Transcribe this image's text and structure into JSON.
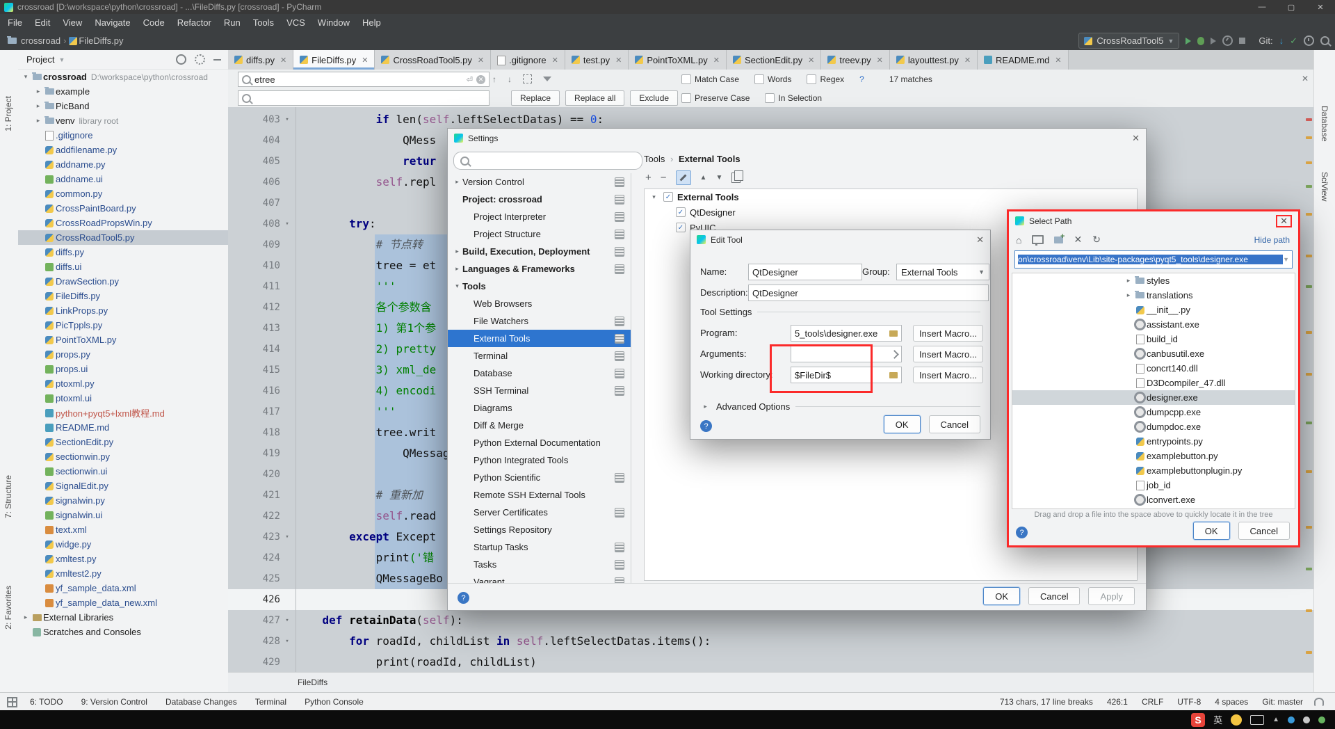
{
  "window": {
    "title": "crossroad [D:\\workspace\\python\\crossroad] - ...\\FileDiffs.py [crossroad] - PyCharm"
  },
  "menu": [
    "File",
    "Edit",
    "View",
    "Navigate",
    "Code",
    "Refactor",
    "Run",
    "Tools",
    "VCS",
    "Window",
    "Help"
  ],
  "nav": {
    "crumb1": "crossroad",
    "crumb2": "FileDiffs.py",
    "run_config": "CrossRoadTool5",
    "git_label": "Git:"
  },
  "stripes": {
    "left_top": "1: Project",
    "left_mid": "7: Structure",
    "left_bottom": "2: Favorites",
    "right_top": "Database",
    "right_bottom": "SciView"
  },
  "project": {
    "header": "Project",
    "items": [
      {
        "name": "crossroad",
        "suffix": "D:\\workspace\\python\\crossroad",
        "icon": "folder",
        "lvl": 0,
        "chev": "open",
        "bold": true,
        "color": "plain"
      },
      {
        "name": "example",
        "icon": "folder",
        "lvl": 1,
        "chev": "closed",
        "color": "plain"
      },
      {
        "name": "PicBand",
        "icon": "folder",
        "lvl": 1,
        "chev": "closed",
        "color": "plain"
      },
      {
        "name": "venv",
        "suffix": "library root",
        "icon": "folder",
        "lvl": 1,
        "chev": "closed",
        "color": "plain"
      },
      {
        "name": ".gitignore",
        "icon": "file",
        "lvl": 1,
        "color": "blue"
      },
      {
        "name": "addfilename.py",
        "icon": "py",
        "lvl": 1,
        "color": "blue"
      },
      {
        "name": "addname.py",
        "icon": "py",
        "lvl": 1,
        "color": "blue"
      },
      {
        "name": "addname.ui",
        "icon": "ui",
        "lvl": 1,
        "color": "blue"
      },
      {
        "name": "common.py",
        "icon": "py",
        "lvl": 1,
        "color": "blue"
      },
      {
        "name": "CrossPaintBoard.py",
        "icon": "py",
        "lvl": 1,
        "color": "blue"
      },
      {
        "name": "CrossRoadPropsWin.py",
        "icon": "py",
        "lvl": 1,
        "color": "blue"
      },
      {
        "name": "CrossRoadTool5.py",
        "icon": "py",
        "lvl": 1,
        "color": "blue",
        "sel": true
      },
      {
        "name": "diffs.py",
        "icon": "py",
        "lvl": 1,
        "color": "blue"
      },
      {
        "name": "diffs.ui",
        "icon": "ui",
        "lvl": 1,
        "color": "blue"
      },
      {
        "name": "DrawSection.py",
        "icon": "py",
        "lvl": 1,
        "color": "blue"
      },
      {
        "name": "FileDiffs.py",
        "icon": "py",
        "lvl": 1,
        "color": "blue"
      },
      {
        "name": "LinkProps.py",
        "icon": "py",
        "lvl": 1,
        "color": "blue"
      },
      {
        "name": "PicTppls.py",
        "icon": "py",
        "lvl": 1,
        "color": "blue"
      },
      {
        "name": "PointToXML.py",
        "icon": "py",
        "lvl": 1,
        "color": "blue"
      },
      {
        "name": "props.py",
        "icon": "py",
        "lvl": 1,
        "color": "blue"
      },
      {
        "name": "props.ui",
        "icon": "ui",
        "lvl": 1,
        "color": "blue"
      },
      {
        "name": "ptoxml.py",
        "icon": "py",
        "lvl": 1,
        "color": "blue"
      },
      {
        "name": "ptoxml.ui",
        "icon": "ui",
        "lvl": 1,
        "color": "blue"
      },
      {
        "name": "python+pyqt5+lxml教程.md",
        "icon": "md",
        "lvl": 1,
        "color": "red"
      },
      {
        "name": "README.md",
        "icon": "md",
        "lvl": 1,
        "color": "blue"
      },
      {
        "name": "SectionEdit.py",
        "icon": "py",
        "lvl": 1,
        "color": "blue"
      },
      {
        "name": "sectionwin.py",
        "icon": "py",
        "lvl": 1,
        "color": "blue"
      },
      {
        "name": "sectionwin.ui",
        "icon": "ui",
        "lvl": 1,
        "color": "blue"
      },
      {
        "name": "SignalEdit.py",
        "icon": "py",
        "lvl": 1,
        "color": "blue"
      },
      {
        "name": "signalwin.py",
        "icon": "py",
        "lvl": 1,
        "color": "blue"
      },
      {
        "name": "signalwin.ui",
        "icon": "ui",
        "lvl": 1,
        "color": "blue"
      },
      {
        "name": "text.xml",
        "icon": "xml",
        "lvl": 1,
        "color": "blue"
      },
      {
        "name": "widge.py",
        "icon": "py",
        "lvl": 1,
        "color": "blue"
      },
      {
        "name": "xmltest.py",
        "icon": "py",
        "lvl": 1,
        "color": "blue"
      },
      {
        "name": "xmltest2.py",
        "icon": "py",
        "lvl": 1,
        "color": "blue"
      },
      {
        "name": "yf_sample_data.xml",
        "icon": "xml",
        "lvl": 1,
        "color": "blue"
      },
      {
        "name": "yf_sample_data_new.xml",
        "icon": "xml",
        "lvl": 1,
        "color": "blue"
      },
      {
        "name": "External Libraries",
        "icon": "lib",
        "lvl": 0,
        "chev": "closed",
        "color": "plain"
      },
      {
        "name": "Scratches and Consoles",
        "icon": "scratch",
        "lvl": 0,
        "color": "plain"
      }
    ]
  },
  "editor": {
    "tabs": [
      {
        "label": "diffs.py",
        "icon": "py"
      },
      {
        "label": "FileDiffs.py",
        "icon": "py",
        "active": true
      },
      {
        "label": "CrossRoadTool5.py",
        "icon": "py"
      },
      {
        "label": ".gitignore",
        "icon": "file"
      },
      {
        "label": "test.py",
        "icon": "py"
      },
      {
        "label": "PointToXML.py",
        "icon": "py"
      },
      {
        "label": "SectionEdit.py",
        "icon": "py"
      },
      {
        "label": "treev.py",
        "icon": "py"
      },
      {
        "label": "layouttest.py",
        "icon": "py"
      },
      {
        "label": "README.md",
        "icon": "md"
      }
    ],
    "search": {
      "query": "etree",
      "matches": "17 matches",
      "opt_case": "Match Case",
      "opt_words": "Words",
      "opt_regex": "Regex",
      "regex_help": "?",
      "btn_replace": "Replace",
      "btn_replace_all": "Replace all",
      "btn_exclude": "Exclude",
      "opt_preserve": "Preserve Case",
      "opt_insel": "In Selection"
    },
    "gutter_first": 403,
    "current_line": 426,
    "folds": [
      403,
      408,
      423,
      427,
      428
    ],
    "lines": [
      {
        "ind": 12,
        "seg": [
          [
            "if ",
            "kw"
          ],
          [
            "len(",
            "pl"
          ],
          [
            "self",
            "slf"
          ],
          [
            ".leftSelectDatas) == ",
            "pl"
          ],
          [
            "0",
            "num"
          ],
          [
            ":",
            "pl"
          ]
        ]
      },
      {
        "ind": 16,
        "seg": [
          [
            "QMess",
            "pl"
          ]
        ]
      },
      {
        "ind": 16,
        "seg": [
          [
            "retur",
            "kw"
          ]
        ]
      },
      {
        "ind": 12,
        "seg": [
          [
            "self",
            "slf"
          ],
          [
            ".repl",
            "pl"
          ]
        ]
      },
      {
        "ind": 0,
        "seg": []
      },
      {
        "ind": 8,
        "seg": [
          [
            "try",
            "kw"
          ],
          [
            ":",
            "pl"
          ]
        ]
      },
      {
        "ind": 12,
        "seg": [
          [
            "# 节点转",
            "com"
          ]
        ]
      },
      {
        "ind": 12,
        "seg": [
          [
            "tree = et",
            "pl"
          ]
        ]
      },
      {
        "ind": 12,
        "seg": [
          [
            "'''",
            "str"
          ]
        ]
      },
      {
        "ind": 12,
        "seg": [
          [
            "各个参数含",
            "str"
          ]
        ]
      },
      {
        "ind": 12,
        "seg": [
          [
            "1) 第1个参",
            "str"
          ]
        ]
      },
      {
        "ind": 12,
        "seg": [
          [
            "2) pretty",
            "str"
          ]
        ]
      },
      {
        "ind": 12,
        "seg": [
          [
            "3) xml_de",
            "str"
          ]
        ]
      },
      {
        "ind": 12,
        "seg": [
          [
            "4) encodi",
            "str"
          ]
        ]
      },
      {
        "ind": 12,
        "seg": [
          [
            "'''",
            "str"
          ]
        ]
      },
      {
        "ind": 12,
        "seg": [
          [
            "tree.writ",
            "pl"
          ]
        ]
      },
      {
        "ind": 16,
        "seg": [
          [
            "QMessageBo",
            "pl"
          ]
        ]
      },
      {
        "ind": 0,
        "seg": []
      },
      {
        "ind": 12,
        "seg": [
          [
            "# 重新加",
            "com"
          ]
        ]
      },
      {
        "ind": 12,
        "seg": [
          [
            "self",
            "slf"
          ],
          [
            ".read",
            "pl"
          ]
        ]
      },
      {
        "ind": 8,
        "seg": [
          [
            "except ",
            "kw"
          ],
          [
            "Except",
            "pl"
          ]
        ]
      },
      {
        "ind": 12,
        "seg": [
          [
            "print",
            "pl"
          ],
          [
            "('错",
            "str"
          ]
        ]
      },
      {
        "ind": 12,
        "seg": [
          [
            "QMessageBo",
            "pl"
          ]
        ]
      },
      {
        "ind": 0,
        "seg": []
      },
      {
        "ind": 4,
        "seg": [
          [
            "def ",
            "kw"
          ],
          [
            "retainData",
            "fn"
          ],
          [
            "(",
            "pl"
          ],
          [
            "self",
            "slf"
          ],
          [
            "):",
            "pl"
          ]
        ]
      },
      {
        "ind": 8,
        "seg": [
          [
            "for ",
            "kw"
          ],
          [
            "roadId, childList ",
            "pl"
          ],
          [
            "in ",
            "kw"
          ],
          [
            "self",
            "slf"
          ],
          [
            ".leftSelectDatas.items():",
            "pl"
          ]
        ]
      },
      {
        "ind": 12,
        "seg": [
          [
            "print",
            "pl"
          ],
          [
            "(roadId, childList)",
            "pl"
          ]
        ]
      }
    ],
    "breadcrumb": "FileDiffs",
    "marks": [
      {
        "t": 16,
        "c": "#cf5b56"
      },
      {
        "t": 42,
        "c": "#d9a343"
      },
      {
        "t": 78,
        "c": "#d9a343"
      },
      {
        "t": 112,
        "c": "#7aa35c"
      },
      {
        "t": 152,
        "c": "#d9a343"
      },
      {
        "t": 212,
        "c": "#d9a343"
      },
      {
        "t": 256,
        "c": "#7aa35c"
      },
      {
        "t": 322,
        "c": "#d9a343"
      },
      {
        "t": 382,
        "c": "#d9a343"
      },
      {
        "t": 452,
        "c": "#7aa35c"
      },
      {
        "t": 522,
        "c": "#d9a343"
      },
      {
        "t": 602,
        "c": "#d9a343"
      },
      {
        "t": 662,
        "c": "#7aa35c"
      },
      {
        "t": 722,
        "c": "#d9a343"
      },
      {
        "t": 782,
        "c": "#d9a343"
      }
    ]
  },
  "settings": {
    "title": "Settings",
    "crumb1": "Tools",
    "crumb2": "External Tools",
    "tree": [
      {
        "label": "Version Control",
        "lvl": 0,
        "chev": "closed",
        "badge": true
      },
      {
        "label": "Project: crossroad",
        "lvl": 0,
        "bold": true,
        "badge": true
      },
      {
        "label": "Project Interpreter",
        "lvl": 1,
        "badge": true
      },
      {
        "label": "Project Structure",
        "lvl": 1,
        "badge": true
      },
      {
        "label": "Build, Execution, Deployment",
        "lvl": 0,
        "bold": true,
        "chev": "closed",
        "badge": true
      },
      {
        "label": "Languages & Frameworks",
        "lvl": 0,
        "bold": true,
        "chev": "closed",
        "badge": true
      },
      {
        "label": "Tools",
        "lvl": 0,
        "bold": true,
        "chev": "open"
      },
      {
        "label": "Web Browsers",
        "lvl": 1
      },
      {
        "label": "File Watchers",
        "lvl": 1,
        "badge": true
      },
      {
        "label": "External Tools",
        "lvl": 1,
        "sel": true,
        "badge": true
      },
      {
        "label": "Terminal",
        "lvl": 1,
        "badge": true
      },
      {
        "label": "Database",
        "lvl": 1,
        "badge": true
      },
      {
        "label": "SSH Terminal",
        "lvl": 1,
        "badge": true
      },
      {
        "label": "Diagrams",
        "lvl": 1
      },
      {
        "label": "Diff & Merge",
        "lvl": 1
      },
      {
        "label": "Python External Documentation",
        "lvl": 1
      },
      {
        "label": "Python Integrated Tools",
        "lvl": 1
      },
      {
        "label": "Python Scientific",
        "lvl": 1,
        "badge": true
      },
      {
        "label": "Remote SSH External Tools",
        "lvl": 1
      },
      {
        "label": "Server Certificates",
        "lvl": 1,
        "badge": true
      },
      {
        "label": "Settings Repository",
        "lvl": 1
      },
      {
        "label": "Startup Tasks",
        "lvl": 1,
        "badge": true
      },
      {
        "label": "Tasks",
        "lvl": 1,
        "badge": true
      },
      {
        "label": "Vagrant",
        "lvl": 1,
        "badge": true
      }
    ],
    "tools": [
      {
        "label": "External Tools",
        "chev": true,
        "checked": true,
        "bold": true,
        "lvl": 0
      },
      {
        "label": "QtDesigner",
        "checked": true,
        "lvl": 1
      },
      {
        "label": "PyUIC",
        "checked": true,
        "lvl": 1
      }
    ],
    "ok": "OK",
    "cancel": "Cancel",
    "apply": "Apply"
  },
  "edit_tool": {
    "title": "Edit Tool",
    "name_label": "Name:",
    "name_value": "QtDesigner",
    "group_label": "Group:",
    "group_value": "External Tools",
    "desc_label": "Description:",
    "desc_value": "QtDesigner",
    "section": "Tool Settings",
    "program_label": "Program:",
    "program_value": "5_tools\\designer.exe",
    "arguments_label": "Arguments:",
    "arguments_value": "",
    "workdir_label": "Working directory:",
    "workdir_value": "$FileDir$",
    "insert_macro": "Insert Macro...",
    "advanced": "Advanced Options",
    "ok": "OK",
    "cancel": "Cancel"
  },
  "select_path": {
    "title": "Select Path",
    "hide_path": "Hide path",
    "path_value": "on\\crossroad\\venv\\Lib\\site-packages\\pyqt5_tools\\designer.exe",
    "tree": [
      {
        "label": "styles",
        "icon": "folder",
        "chev": true
      },
      {
        "label": "translations",
        "icon": "folder",
        "chev": true
      },
      {
        "label": "__init__.py",
        "icon": "py"
      },
      {
        "label": "assistant.exe",
        "icon": "exe"
      },
      {
        "label": "build_id",
        "icon": "file"
      },
      {
        "label": "canbusutil.exe",
        "icon": "exe"
      },
      {
        "label": "concrt140.dll",
        "icon": "file"
      },
      {
        "label": "D3Dcompiler_47.dll",
        "icon": "file"
      },
      {
        "label": "designer.exe",
        "icon": "exe",
        "sel": true
      },
      {
        "label": "dumpcpp.exe",
        "icon": "exe"
      },
      {
        "label": "dumpdoc.exe",
        "icon": "exe"
      },
      {
        "label": "entrypoints.py",
        "icon": "py"
      },
      {
        "label": "examplebutton.py",
        "icon": "py"
      },
      {
        "label": "examplebuttonplugin.py",
        "icon": "py"
      },
      {
        "label": "job_id",
        "icon": "file"
      },
      {
        "label": "lconvert.exe",
        "icon": "exe"
      }
    ],
    "hint": "Drag and drop a file into the space above to quickly locate it in the tree",
    "ok": "OK",
    "cancel": "Cancel"
  },
  "status": {
    "left": [
      "6: TODO",
      "9: Version Control",
      "Database Changes",
      "Terminal",
      "Python Console"
    ],
    "right": [
      "713 chars, 17 line breaks",
      "426:1",
      "CRLF",
      "UTF-8",
      "4 spaces",
      "Git: master"
    ]
  },
  "taskbar": {
    "lang": "英"
  }
}
